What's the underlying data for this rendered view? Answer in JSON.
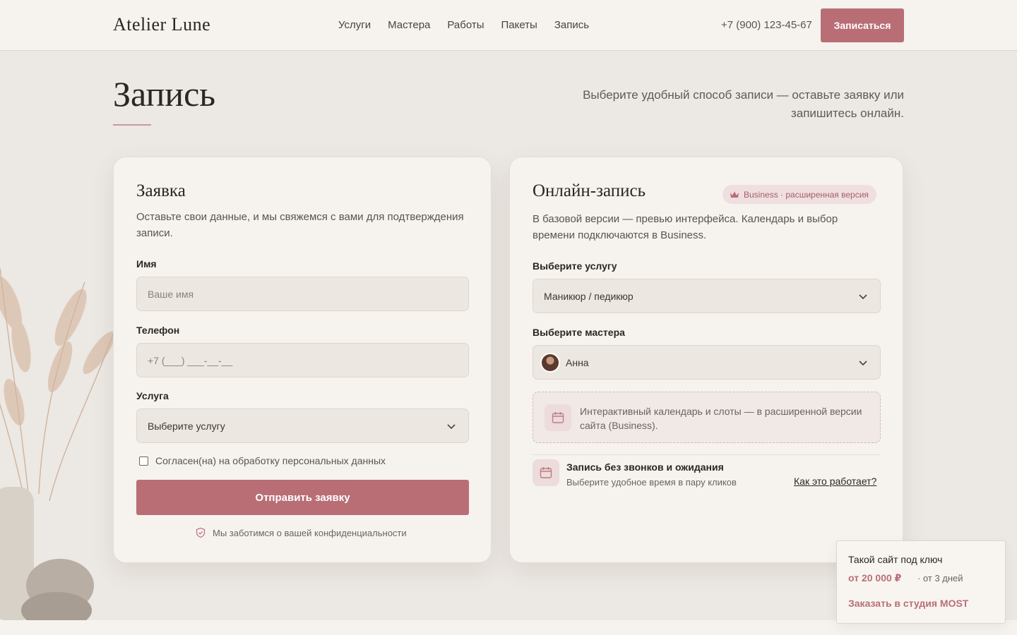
{
  "header": {
    "logo": "Atelier Lune",
    "nav": [
      "Услуги",
      "Мастера",
      "Работы",
      "Пакеты",
      "Запись"
    ],
    "phone": "+7 (900) 123-45-67",
    "cta_label": "Записаться"
  },
  "page": {
    "title": "Запись",
    "subtitle": "Выберите удобный способ записи — оставьте заявку или запишитесь онлайн."
  },
  "request_form": {
    "title": "Заявка",
    "description": "Оставьте свои данные, и мы свяжемся с вами для подтверждения записи.",
    "name_label": "Имя",
    "name_placeholder": "Ваше имя",
    "phone_label": "Телефон",
    "phone_placeholder": "+7 (___) ___-__-__",
    "service_label": "Услуга",
    "service_value": "Выберите услугу",
    "consent_label": "Согласен(на) на обработку персональных данных",
    "consent_checked": false,
    "submit_label": "Отправить заявку",
    "privacy_note": "Мы заботимся о вашей конфиденциальности"
  },
  "online_booking": {
    "title": "Онлайн-запись",
    "badge": "Business · расширенная версия",
    "description": "В базовой версии — превью интерфейса. Календарь и выбор времени подключаются в Business.",
    "service_label": "Выберите услугу",
    "service_value": "Маникюр / педикюр",
    "master_label": "Выберите мастера",
    "master_value": "Анна",
    "calendar_note": "Интерактивный календарь и слоты — в расширенной версии сайта (Business).",
    "info_title": "Запись без звонков и ожидания",
    "info_subtitle": "Выберите удобное время в пару кликов",
    "info_link": "Как это работает?"
  },
  "promo": {
    "title": "Такой сайт под ключ",
    "price": "от 20 000 ₽",
    "term": "· от 3 дней",
    "link": "Заказать в студия MOST"
  },
  "colors": {
    "accent": "#b96e76",
    "background": "#ece8e3",
    "card": "#f6f3ef",
    "text": "#2b2623"
  },
  "icons": [
    "chevron-down-icon",
    "shield-icon",
    "crown-icon",
    "calendar-icon"
  ]
}
